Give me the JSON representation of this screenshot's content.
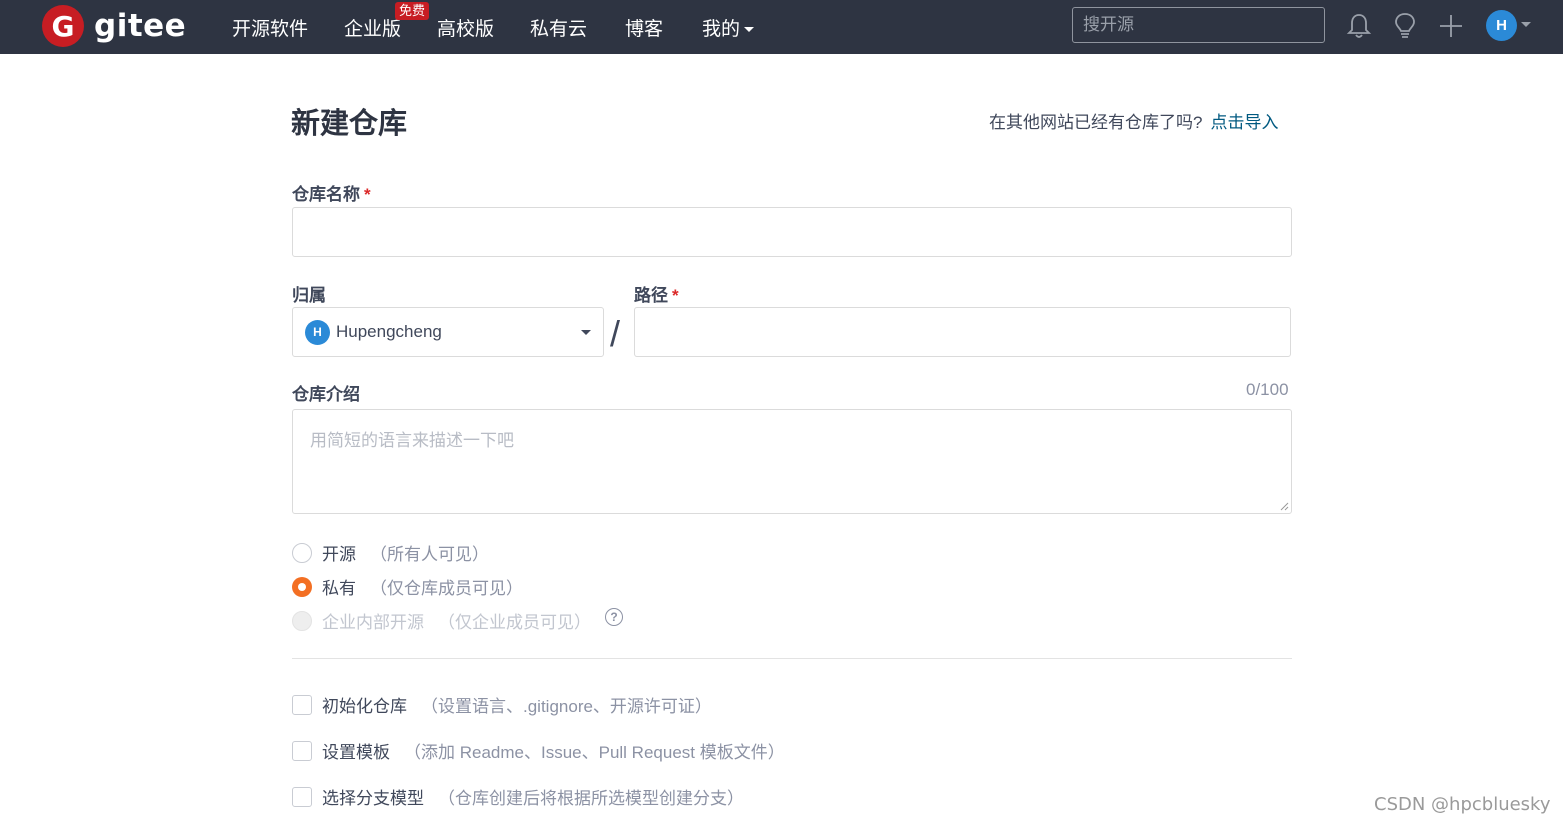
{
  "nav": {
    "logo_letter": "G",
    "logo_text": "gitee",
    "items": [
      "开源软件",
      "企业版",
      "高校版",
      "私有云",
      "博客",
      "我的"
    ],
    "free_badge": "免费",
    "search_placeholder": "搜开源",
    "icons": [
      "bell-icon",
      "lightbulb-icon",
      "plus-icon"
    ],
    "avatar_letter": "H"
  },
  "page": {
    "title": "新建仓库",
    "import_prompt": "在其他网站已经有仓库了吗?",
    "import_link": "点击导入"
  },
  "form": {
    "repo_name_label": "仓库名称",
    "required_mark": "*",
    "owner_label": "归属",
    "owner_avatar_letter": "H",
    "owner_value": "Hupengcheng",
    "separator": "/",
    "path_label": "路径",
    "desc_label": "仓库介绍",
    "desc_counter": "0/100",
    "desc_placeholder": "用简短的语言来描述一下吧",
    "visibility": [
      {
        "label": "开源",
        "hint": "（所有人可见）",
        "selected": false,
        "disabled": false
      },
      {
        "label": "私有",
        "hint": "（仅仓库成员可见）",
        "selected": true,
        "disabled": false
      },
      {
        "label": "企业内部开源",
        "hint": "（仅企业成员可见）",
        "selected": false,
        "disabled": true
      }
    ],
    "help_glyph": "?",
    "options": [
      {
        "label": "初始化仓库",
        "hint": "（设置语言、.gitignore、开源许可证）"
      },
      {
        "label": "设置模板",
        "hint": "（添加 Readme、Issue、Pull Request 模板文件）"
      },
      {
        "label": "选择分支模型",
        "hint": "（仓库创建后将根据所选模型创建分支）"
      }
    ]
  },
  "watermark": "CSDN @hpcbluesky",
  "colors": {
    "nav_bg": "#2e3442",
    "brand_red": "#c71d23",
    "accent_orange": "#f36f23",
    "link": "#005980"
  }
}
